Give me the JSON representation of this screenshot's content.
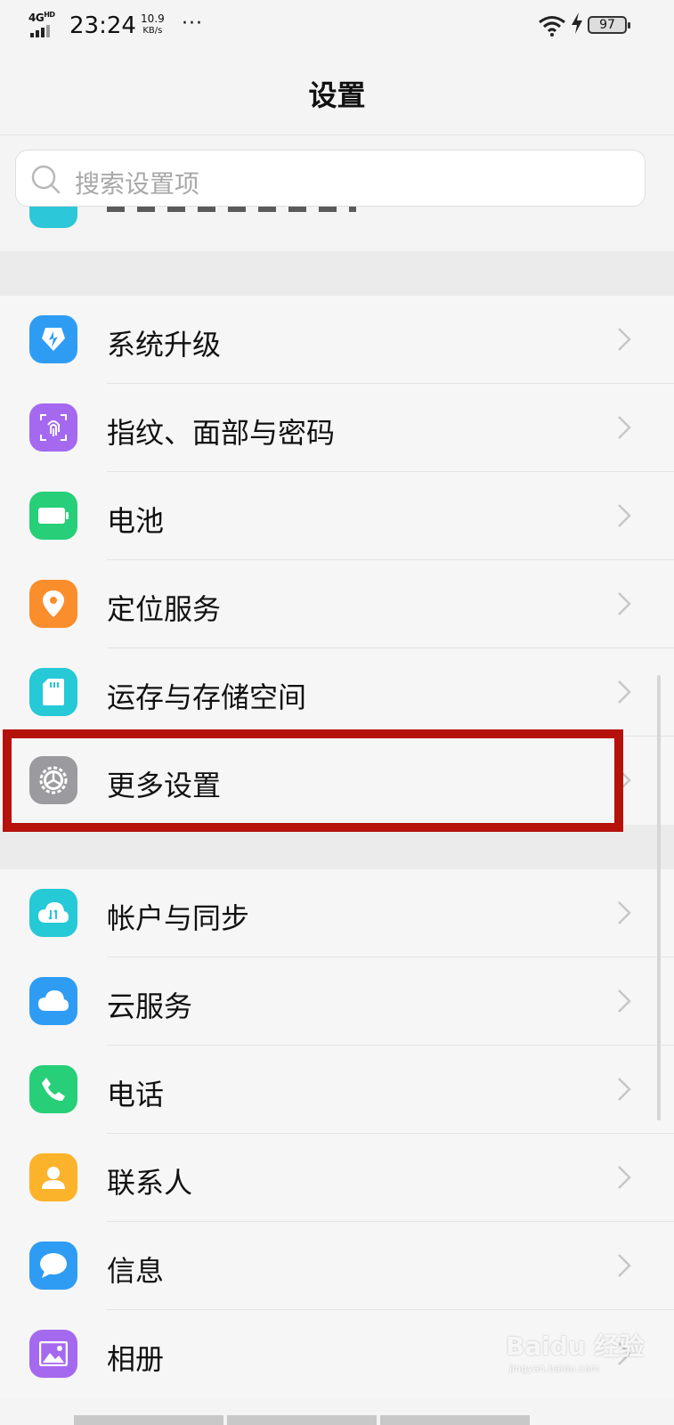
{
  "status_bar": {
    "network": "4G",
    "network_sup": "HD",
    "time": "23:24",
    "speed_value": "10.9",
    "speed_unit": "KB/s",
    "more": "···",
    "battery": "97"
  },
  "header": {
    "title": "设置"
  },
  "search": {
    "placeholder": "搜索设置项"
  },
  "group1": [
    {
      "label": "系统升级",
      "icon": "system-upgrade-icon",
      "color": "#2f9cf4"
    },
    {
      "label": "指纹、面部与密码",
      "icon": "fingerprint-icon",
      "color": "#a569f0"
    },
    {
      "label": "电池",
      "icon": "battery-icon",
      "color": "#27cf78"
    },
    {
      "label": "定位服务",
      "icon": "location-icon",
      "color": "#fb8e2c"
    },
    {
      "label": "运存与存储空间",
      "icon": "storage-icon",
      "color": "#26c9d6"
    },
    {
      "label": "更多设置",
      "icon": "more-settings-gear-icon",
      "color": "#9b9b9f"
    }
  ],
  "group2": [
    {
      "label": "帐户与同步",
      "icon": "account-sync-icon",
      "color": "#26c9d6"
    },
    {
      "label": "云服务",
      "icon": "cloud-icon",
      "color": "#2f9cf4"
    },
    {
      "label": "电话",
      "icon": "phone-icon",
      "color": "#27cf78"
    },
    {
      "label": "联系人",
      "icon": "contacts-icon",
      "color": "#fbb32c"
    },
    {
      "label": "信息",
      "icon": "message-icon",
      "color": "#2f9cf4"
    },
    {
      "label": "相册",
      "icon": "album-icon",
      "color": "#a569f0"
    }
  ],
  "watermark": {
    "main": "Baidu 经验",
    "sub": "jingyan.baidu.com"
  }
}
